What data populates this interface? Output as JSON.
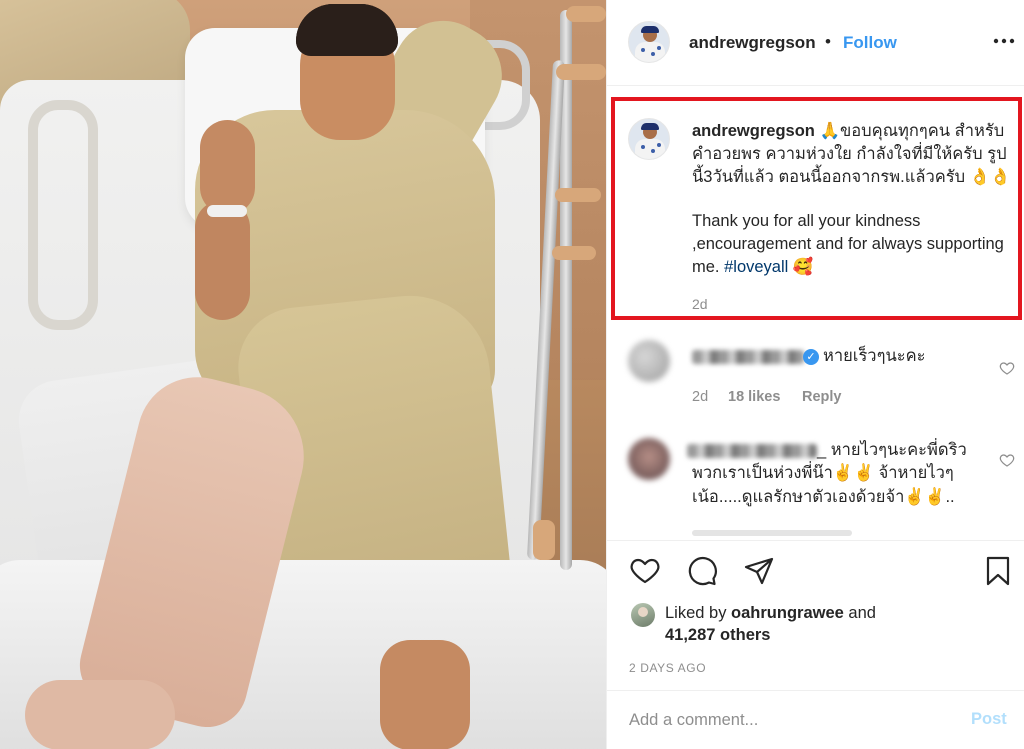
{
  "post": {
    "username": "andrewgregson",
    "dot": "•",
    "follow_label": "Follow",
    "more_icon": "more-dots-icon"
  },
  "caption": {
    "username": "andrewgregson",
    "thai_text": "🙏ขอบคุณทุกๆคน สำหรับคำอวยพร ความห่วงใย กำลังใจที่มีให้ครับ รูปนี้3วันที่แล้ว ตอนนี้ออกจากรพ.แล้วครับ 👌👌",
    "english_text": "Thank you for all your kindness ,encouragement and for always supporting me.",
    "hashtag": "#loveyall",
    "emoji": "🥰",
    "time": "2d",
    "highlight_color": "#e3161f"
  },
  "comments": [
    {
      "text": "หายเร็วๆนะคะ",
      "time": "2d",
      "likes": "18 likes",
      "reply": "Reply"
    },
    {
      "text_line1": "_ หายไวๆนะคะพี่ดริว",
      "text_line2": "พวกเราเป็นห่วงพี่น๊า✌️✌️ จ้าหายไวๆ",
      "text_line3": "เน้อ.....ดูแลรักษาตัวเองด้วยจ้า✌️✌️.."
    }
  ],
  "likes": {
    "prefix": "Liked by ",
    "user": "oahrungrawee",
    "and": " and",
    "others": "41,287 others"
  },
  "timestamp": "2 DAYS AGO",
  "comment_box": {
    "placeholder": "Add a comment...",
    "post_label": "Post"
  },
  "colors": {
    "link": "#3897f0",
    "hashtag": "#00376b",
    "muted": "#8e8e8e",
    "post_disabled": "#b2dffc"
  }
}
